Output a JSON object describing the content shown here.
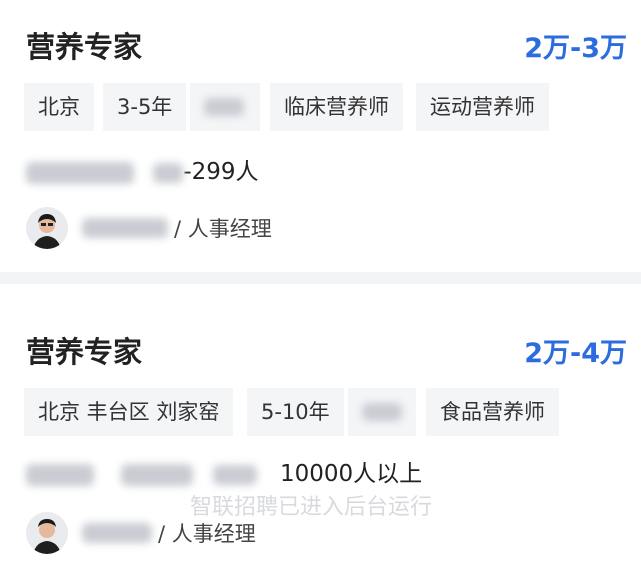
{
  "jobs": [
    {
      "title": "营养专家",
      "salary": "2万-3万",
      "tags": [
        "北京",
        "3-5年",
        "",
        "临床营养师",
        "运动营养师"
      ],
      "company_size": "-299人",
      "recruiter_role": "/ 人事经理"
    },
    {
      "title": "营养专家",
      "salary": "2万-4万",
      "tags": [
        "北京 丰台区 刘家窑",
        "5-10年",
        "",
        "食品营养师"
      ],
      "company_size": "10000人以上",
      "recruiter_role": "/ 人事经理"
    }
  ],
  "toast": "智联招聘已进入后台运行"
}
